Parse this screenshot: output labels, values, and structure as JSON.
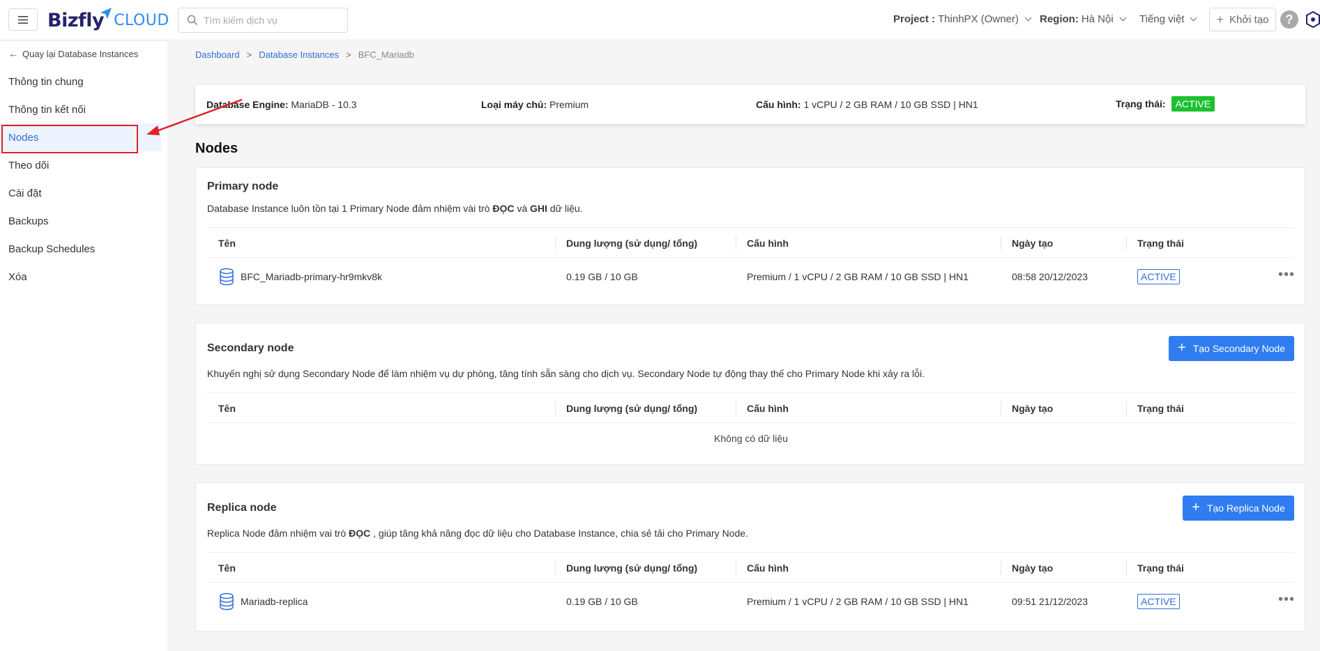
{
  "header": {
    "logo_main": "Bizfly",
    "logo_sub": "CLOUD",
    "search_placeholder": "Tìm kiếm dịch vụ",
    "project_label": "Project :",
    "project_value": "ThinhPX (Owner)",
    "region_label": "Region:",
    "region_value": "Hà Nội",
    "language": "Tiếng việt",
    "create_label": "Khởi tạo",
    "help": "?"
  },
  "sidebar": {
    "back": "Quay lại Database Instances",
    "items": [
      {
        "label": "Thông tin chung",
        "active": false
      },
      {
        "label": "Thông tin kết nối",
        "active": false
      },
      {
        "label": "Nodes",
        "active": true
      },
      {
        "label": "Theo dõi",
        "active": false
      },
      {
        "label": "Cài đặt",
        "active": false
      },
      {
        "label": "Backups",
        "active": false
      },
      {
        "label": "Backup Schedules",
        "active": false
      },
      {
        "label": "Xóa",
        "active": false
      }
    ]
  },
  "breadcrumb": {
    "items": [
      "Dashboard",
      "Database Instances",
      "BFC_Mariadb"
    ],
    "sep": ">"
  },
  "info": {
    "engine_label": "Database Engine:",
    "engine_value": "MariaDB - 10.3",
    "server_label": "Loại máy chủ:",
    "server_value": "Premium",
    "config_label": "Cấu hình:",
    "config_value": "1 vCPU / 2 GB RAM / 10 GB SSD | HN1",
    "status_label": "Trạng thái:",
    "status_value": "ACTIVE"
  },
  "page_title": "Nodes",
  "columns": [
    "Tên",
    "Dung lượng (sử dụng/ tổng)",
    "Cấu hình",
    "Ngày tạo",
    "Trạng thái"
  ],
  "primary": {
    "title": "Primary node",
    "desc_pre": "Database Instance luôn tồn tại 1 Primary Node đảm nhiệm vài trò ",
    "desc_b1": "ĐỌC",
    "desc_mid": " và ",
    "desc_b2": "GHI",
    "desc_post": " dữ liệu.",
    "row": {
      "name": "BFC_Mariadb-primary-hr9mkv8k",
      "storage": "0.19 GB / 10 GB",
      "config": "Premium / 1 vCPU / 2 GB RAM / 10 GB SSD | HN1",
      "created": "08:58 20/12/2023",
      "status": "ACTIVE"
    }
  },
  "secondary": {
    "title": "Secondary node",
    "button": "Tạo Secondary Node",
    "desc": "Khuyến nghị sử dụng Secondary Node để làm nhiệm vụ dự phòng, tăng tính sẵn sàng cho dịch vụ. Secondary Node tự động thay thế cho Primary Node khi xảy ra lỗi.",
    "empty": "Không có dữ liệu"
  },
  "replica": {
    "title": "Replica node",
    "button": "Tạo Replica Node",
    "desc_pre": "Replica Node đảm nhiệm vai trò ",
    "desc_b1": "ĐỌC",
    "desc_post": " , giúp tăng khả năng đọc dữ liệu cho Database Instance, chia sẻ tải cho Primary Node.",
    "row": {
      "name": "Mariadb-replica",
      "storage": "0.19 GB / 10 GB",
      "config": "Premium / 1 vCPU / 2 GB RAM / 10 GB SSD | HN1",
      "created": "09:51 21/12/2023",
      "status": "ACTIVE"
    }
  },
  "colors": {
    "accent": "#2f7df0",
    "active_green": "#1dc030",
    "annotation_red": "#e0202a"
  }
}
